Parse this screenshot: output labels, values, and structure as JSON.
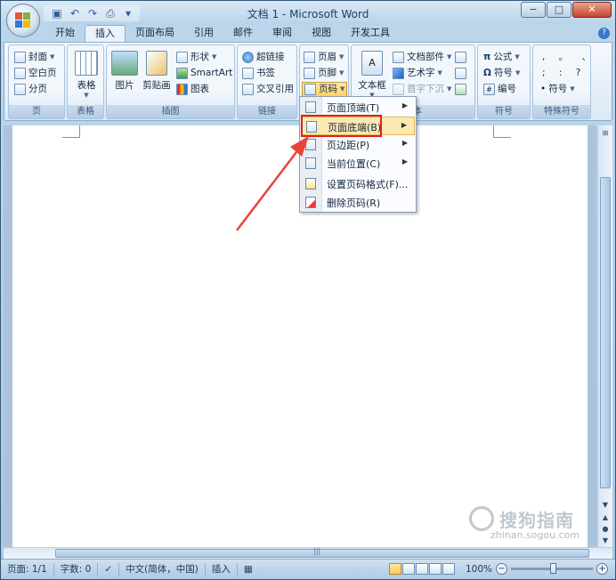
{
  "window": {
    "title": "文档 1 - Microsoft Word",
    "controls": {
      "minimize": "−",
      "maximize": "□",
      "close": "✕"
    }
  },
  "quick_access": {
    "save_icon": "save-icon",
    "undo_icon": "undo-icon",
    "redo_icon": "redo-icon",
    "preview_icon": "print-preview-icon",
    "dropdown": "▾"
  },
  "tabs": [
    {
      "label": "开始"
    },
    {
      "label": "插入"
    },
    {
      "label": "页面布局"
    },
    {
      "label": "引用"
    },
    {
      "label": "邮件"
    },
    {
      "label": "审阅"
    },
    {
      "label": "视图"
    },
    {
      "label": "开发工具"
    }
  ],
  "active_tab": "插入",
  "ribbon": {
    "page_group": {
      "label": "页",
      "items": [
        "封面",
        "空白页",
        "分页"
      ]
    },
    "table_group": {
      "label": "表格",
      "button": "表格"
    },
    "illustrations_group": {
      "label": "插图",
      "picture": "图片",
      "clipart": "剪贴画",
      "shapes": "形状",
      "smartart": "SmartArt",
      "chart": "图表"
    },
    "links_group": {
      "label": "链接",
      "hyperlink": "超链接",
      "bookmark": "书签",
      "crossref": "交叉引用"
    },
    "header_footer_group": {
      "header": "页眉",
      "footer": "页脚",
      "page_number": "页码"
    },
    "text_group": {
      "label": "文本",
      "textbox": "文本框",
      "quickparts": "文档部件",
      "wordart": "艺术字",
      "dropcap": "首字下沉"
    },
    "symbols_group": {
      "label": "符号",
      "equation": "公式",
      "symbol": "符号",
      "number": "编号"
    },
    "special_group": {
      "label": "特殊符号",
      "row1": ", 。 、",
      "row2": "; : ?",
      "symbol": "符号"
    }
  },
  "page_number_menu": {
    "items": [
      {
        "label": "页面顶端(T)",
        "submenu": true
      },
      {
        "label": "页面底端(B)",
        "submenu": true,
        "highlighted": true
      },
      {
        "label": "页边距(P)",
        "submenu": true
      },
      {
        "label": "当前位置(C)",
        "submenu": true
      },
      {
        "label": "设置页码格式(F)...",
        "submenu": false
      },
      {
        "label": "删除页码(R)",
        "submenu": false
      }
    ]
  },
  "statusbar": {
    "page": "页面: 1/1",
    "words": "字数: 0",
    "language": "中文(简体，中国)",
    "mode": "插入",
    "zoom": "100%"
  },
  "watermark": {
    "text": "搜狗指南",
    "url": "zhinan.sogou.com"
  },
  "colors": {
    "highlight_border": "#e02020",
    "arrow": "#e8433a",
    "menu_hover": "#fce8b1"
  }
}
